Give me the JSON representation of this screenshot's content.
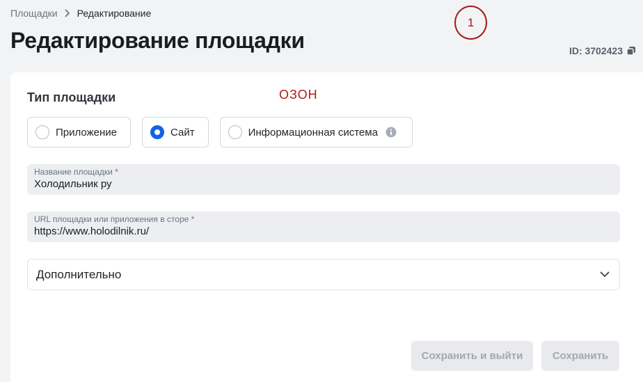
{
  "breadcrumb": {
    "items": [
      "Площадки",
      "Редактирование"
    ]
  },
  "page": {
    "title": "Редактирование площадки",
    "id_label": "ID: 3702423"
  },
  "annotation": {
    "circle_number": "1",
    "note": "ОЗОН",
    "note_color": "#b01a1a"
  },
  "form": {
    "platform_type": {
      "label": "Тип площадки",
      "options": [
        {
          "label": "Приложение",
          "selected": false
        },
        {
          "label": "Сайт",
          "selected": true
        },
        {
          "label": "Информационная система",
          "selected": false,
          "has_info": true
        }
      ]
    },
    "name_field": {
      "label": "Название площадки *",
      "value": "Холодильник ру"
    },
    "url_field": {
      "label": "URL площадки или приложения в сторе *",
      "value": "https://www.holodilnik.ru/"
    },
    "additional": {
      "label": "Дополнительно"
    }
  },
  "actions": {
    "save_exit_label": "Сохранить и выйти",
    "save_label": "Сохранить"
  },
  "colors": {
    "accent": "#1463e6",
    "annotation": "#a31a1a",
    "button_disabled_bg": "#e8eaee",
    "button_disabled_text": "#a3a8b1"
  }
}
